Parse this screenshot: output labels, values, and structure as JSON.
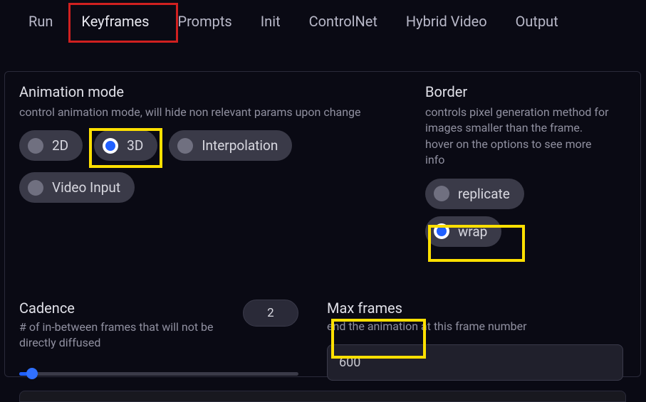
{
  "tabs": {
    "run": "Run",
    "keyframes": "Keyframes",
    "prompts": "Prompts",
    "init": "Init",
    "controlnet": "ControlNet",
    "hybrid": "Hybrid Video",
    "output": "Output",
    "active": "keyframes"
  },
  "anim": {
    "title": "Animation mode",
    "desc": "control animation mode, will hide non relevant params upon change",
    "options": {
      "2d": "2D",
      "3d": "3D",
      "interp": "Interpolation",
      "video": "Video Input"
    },
    "selected": "3d"
  },
  "border": {
    "title": "Border",
    "desc": "controls pixel generation method for images smaller than the frame. hover on the options to see more info",
    "options": {
      "replicate": "replicate",
      "wrap": "wrap"
    },
    "selected": "wrap"
  },
  "cadence": {
    "title": "Cadence",
    "desc": "# of in-between frames that will not be directly diffused",
    "value": "2"
  },
  "maxframes": {
    "title": "Max frames",
    "desc": "end the animation at this frame number",
    "value": "600"
  }
}
